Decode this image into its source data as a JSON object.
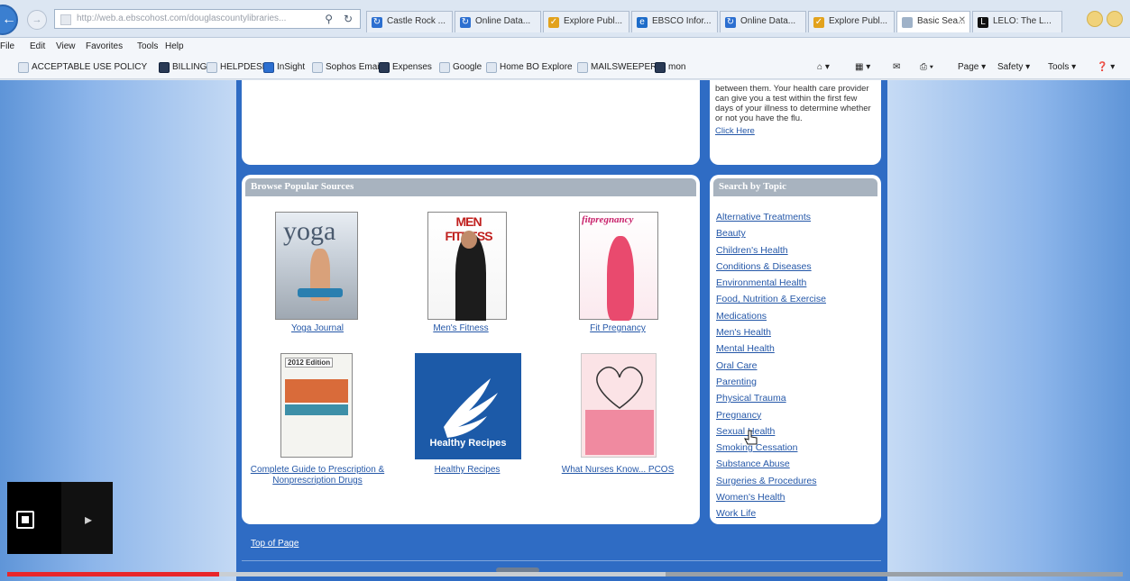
{
  "browser": {
    "url": "http://web.a.ebscohost.com/douglascountylibraries...",
    "tabs": [
      {
        "label": "Castle Rock ...",
        "icon": "reload-icon",
        "color": "#2c6fd0"
      },
      {
        "label": "Online Data...",
        "icon": "reload-icon",
        "color": "#2c6fd0"
      },
      {
        "label": "Explore Publ...",
        "icon": "explore-icon",
        "color": "#e2a21c"
      },
      {
        "label": "EBSCO Infor...",
        "icon": "ebsco-icon",
        "color": "#1d6cc9"
      },
      {
        "label": "Online Data...",
        "icon": "reload-icon",
        "color": "#2c6fd0"
      },
      {
        "label": "Explore Publ...",
        "icon": "explore-icon",
        "color": "#e2a21c"
      },
      {
        "label": "Basic Sea...",
        "icon": "page-icon",
        "color": "#9fb2c8",
        "active": true
      },
      {
        "label": "LELO: The L...",
        "icon": "lelo-icon",
        "color": "#111111"
      }
    ],
    "menu": [
      "File",
      "Edit",
      "View",
      "Favorites",
      "Tools",
      "Help"
    ],
    "favorites": [
      "ACCEPTABLE USE POLICY",
      "BILLING",
      "HELPDESK",
      "InSight",
      "Sophos Email",
      "Expenses",
      "Google",
      "Home BO Explore",
      "MAILSWEEPER",
      "mon"
    ],
    "commands": [
      "Page ▾",
      "Safety ▾",
      "Tools ▾"
    ]
  },
  "flu_card": {
    "text": "between them. Your health care provider can give you a test within the first few days of your illness to determine whether or not you have the flu.",
    "link": "Click Here"
  },
  "popular": {
    "title": "Browse Popular Sources",
    "sources": [
      {
        "label": "Yoga Journal",
        "cover_text": "yoga"
      },
      {
        "label": "Men's Fitness",
        "cover_text": "MEN FITNESS"
      },
      {
        "label": "Fit Pregnancy",
        "cover_text": "fitpregnancy"
      },
      {
        "label": "Complete Guide to Prescription & Nonprescription Drugs",
        "cover_text": "2012 Edition"
      },
      {
        "label": "Healthy Recipes",
        "cover_text": "Healthy Recipes"
      },
      {
        "label": "What Nurses Know... PCOS",
        "cover_text": ""
      }
    ]
  },
  "topics": {
    "title": "Search by Topic",
    "items": [
      "Alternative Treatments",
      "Beauty",
      "Children's Health",
      "Conditions & Diseases",
      "Environmental Health",
      "Food, Nutrition & Exercise",
      "Medications",
      "Men's Health",
      "Mental Health",
      "Oral Care",
      "Parenting",
      "Physical Trauma",
      "Pregnancy",
      "Sexual Health",
      "Smoking Cessation",
      "Substance Abuse",
      "Surgeries & Procedures",
      "Women's Health",
      "Work Life"
    ]
  },
  "footer": {
    "top_of_page": "Top of Page"
  },
  "player": {
    "progress": 0.19,
    "buffered": 0.59,
    "accent": "#e8262a"
  }
}
